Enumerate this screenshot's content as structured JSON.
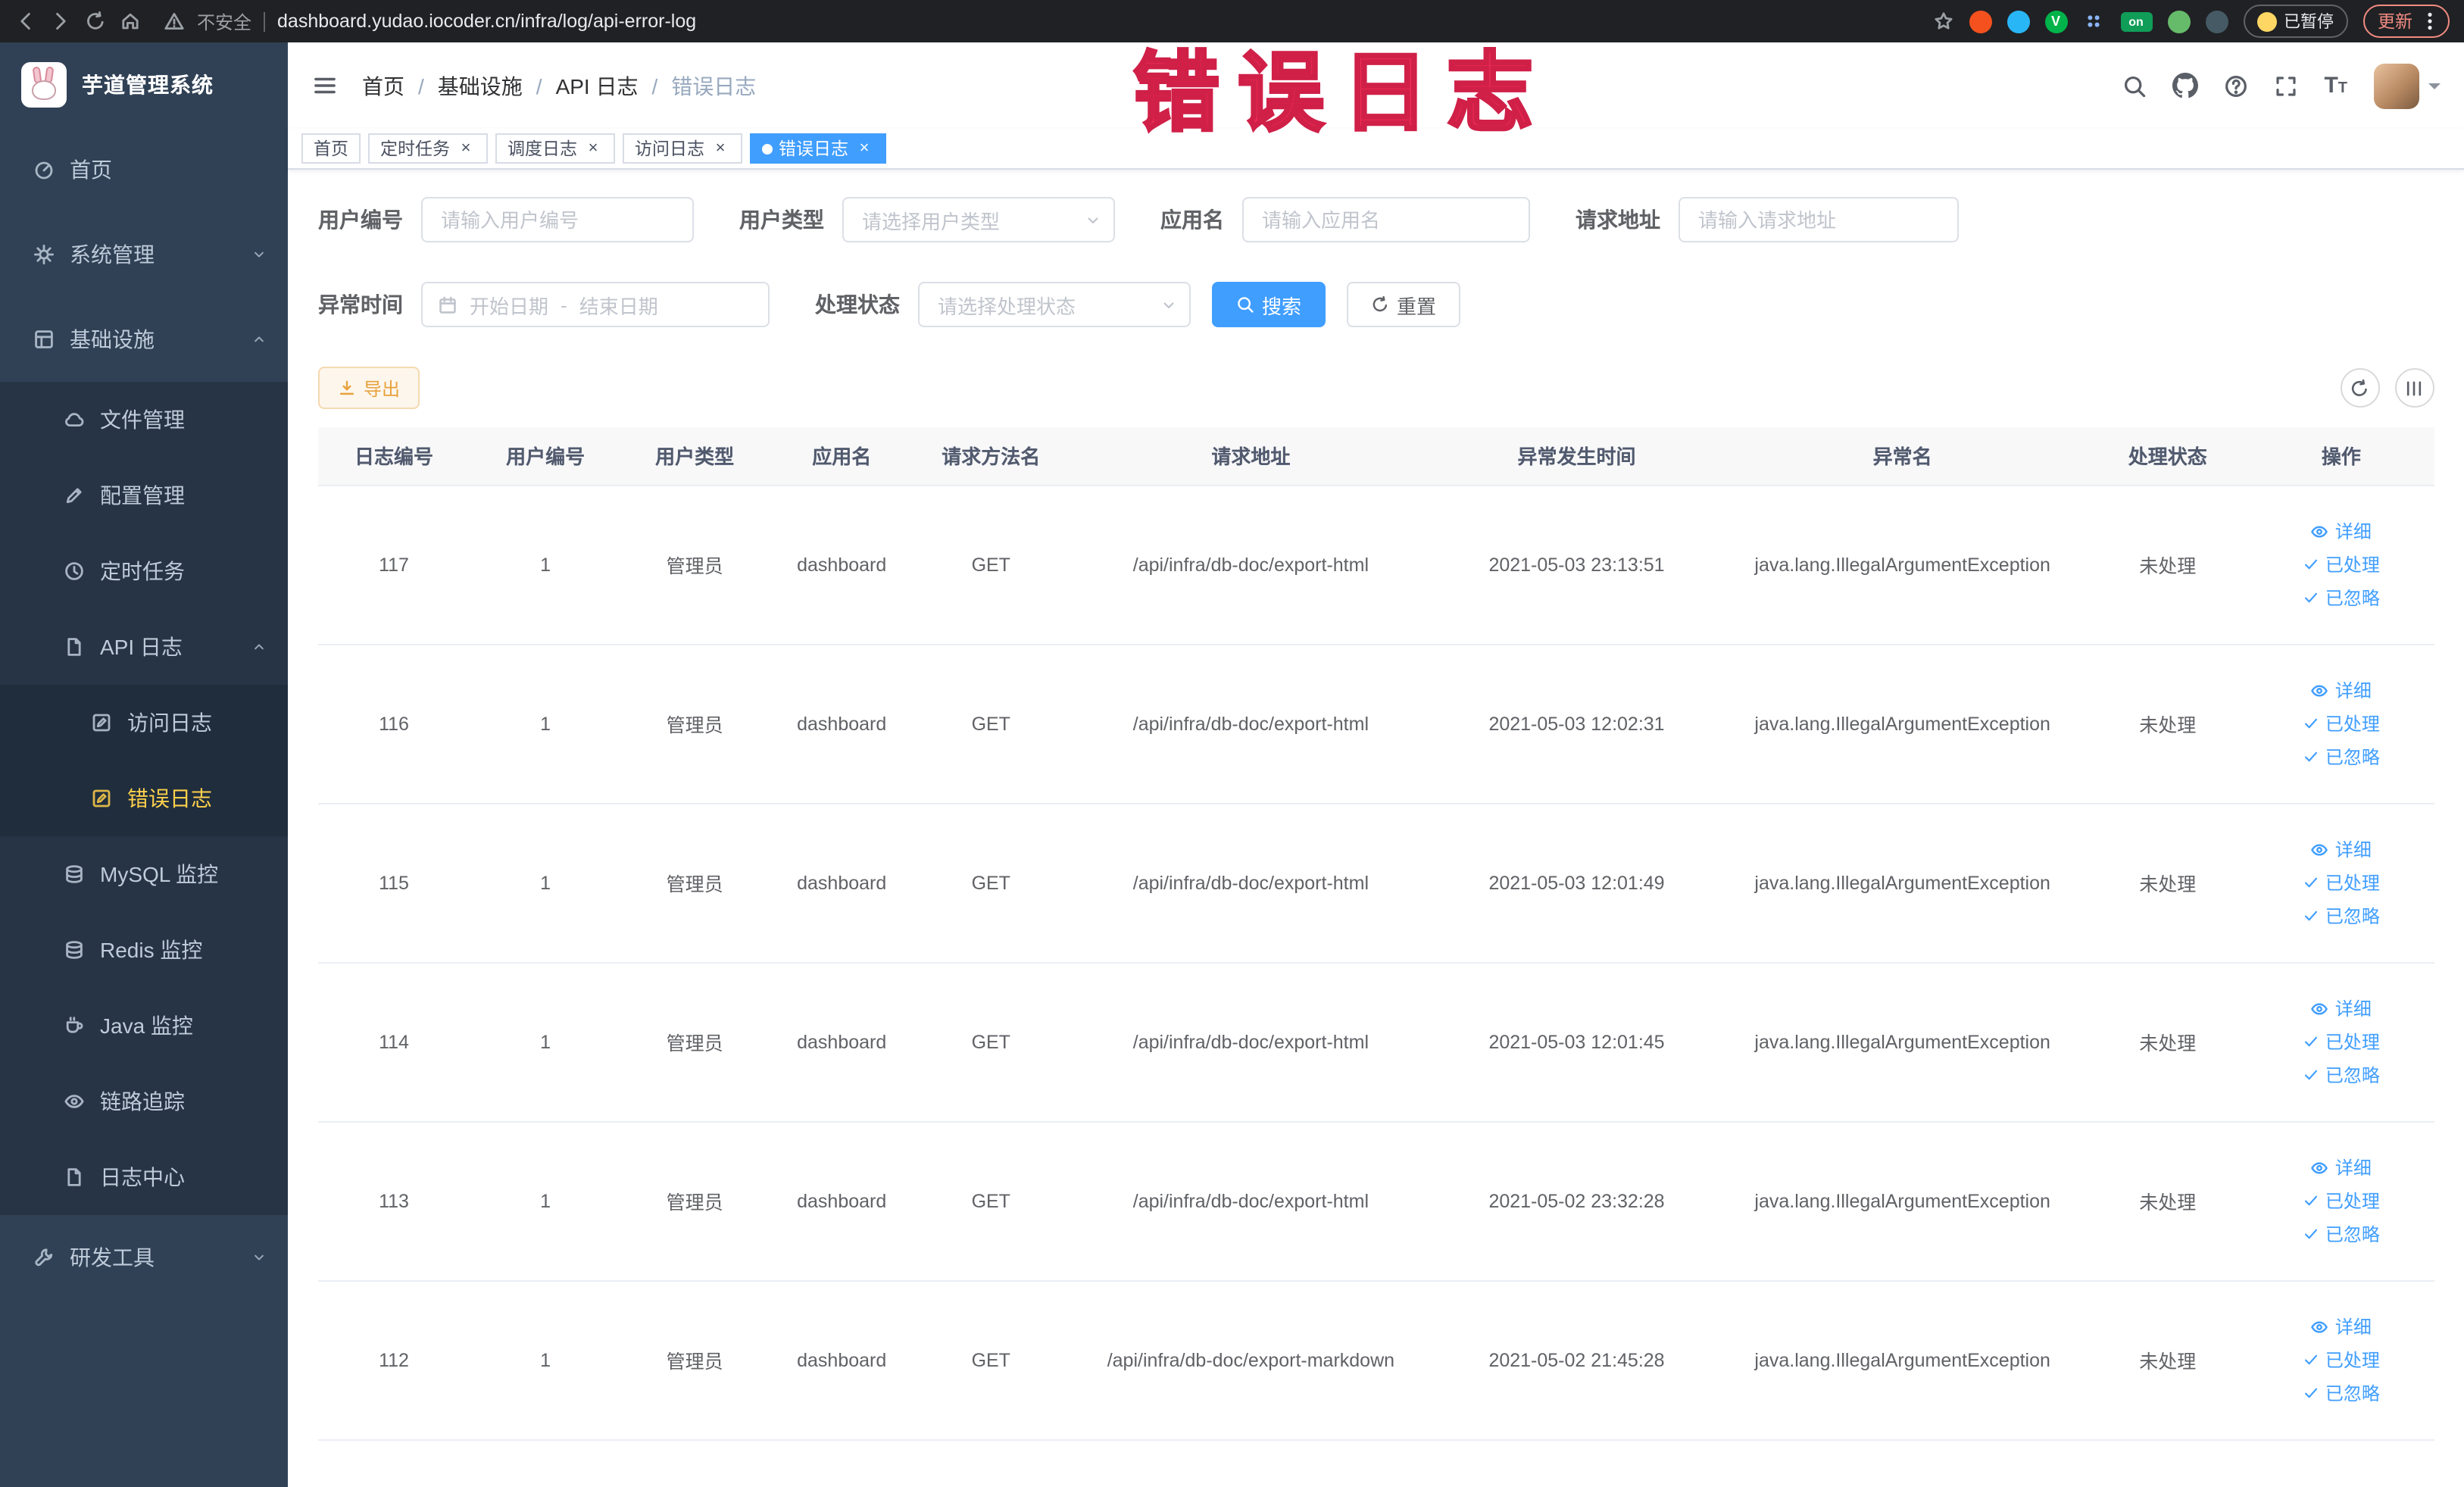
{
  "annotation": {
    "text": "错误日志"
  },
  "colors": {
    "primary": "#409eff",
    "menu_active": "#ffd04b",
    "warning": "#e6a23c",
    "annotation": "#ee2d55",
    "sidebar_bg": "#304156"
  },
  "browser": {
    "security_label": "不安全",
    "url": "dashboard.yudao.iocoder.cn/infra/log/api-error-log",
    "paused_badge": "已暂停",
    "update_button": "更新"
  },
  "sidebar": {
    "logo_title": "芋道管理系统",
    "items": [
      {
        "key": "home",
        "label": "首页",
        "level": 1,
        "icon": "home"
      },
      {
        "key": "system",
        "label": "系统管理",
        "level": 1,
        "icon": "gear",
        "chevron": "down"
      },
      {
        "key": "infra",
        "label": "基础设施",
        "level": 1,
        "icon": "grid",
        "chevron": "up"
      },
      {
        "key": "file",
        "label": "文件管理",
        "level": 2,
        "icon": "cloud"
      },
      {
        "key": "config",
        "label": "配置管理",
        "level": 2,
        "icon": "edit"
      },
      {
        "key": "job",
        "label": "定时任务",
        "level": 2,
        "icon": "clock"
      },
      {
        "key": "api-log",
        "label": "API 日志",
        "level": 2,
        "icon": "doc",
        "chevron": "up"
      },
      {
        "key": "access-log",
        "label": "访问日志",
        "level": 3,
        "icon": "editdoc"
      },
      {
        "key": "error-log",
        "label": "错误日志",
        "level": 3,
        "icon": "editdoc",
        "active": true
      },
      {
        "key": "mysql",
        "label": "MySQL 监控",
        "level": 2,
        "icon": "db"
      },
      {
        "key": "redis",
        "label": "Redis 监控",
        "level": 2,
        "icon": "db"
      },
      {
        "key": "java",
        "label": "Java 监控",
        "level": 2,
        "icon": "coffee"
      },
      {
        "key": "tracer",
        "label": "链路追踪",
        "level": 2,
        "icon": "eye"
      },
      {
        "key": "log-center",
        "label": "日志中心",
        "level": 2,
        "icon": "doc"
      },
      {
        "key": "dev-tools",
        "label": "研发工具",
        "level": 1,
        "icon": "tools",
        "chevron": "down"
      }
    ]
  },
  "header": {
    "breadcrumbs": [
      "首页",
      "基础设施",
      "API 日志",
      "错误日志"
    ]
  },
  "tabs": [
    {
      "key": "home",
      "label": "首页",
      "closable": false,
      "active": false
    },
    {
      "key": "job",
      "label": "定时任务",
      "closable": true,
      "active": false
    },
    {
      "key": "job-log",
      "label": "调度日志",
      "closable": true,
      "active": false
    },
    {
      "key": "access-log",
      "label": "访问日志",
      "closable": true,
      "active": false
    },
    {
      "key": "error-log",
      "label": "错误日志",
      "closable": true,
      "active": true
    }
  ],
  "filters": {
    "user_id": {
      "label": "用户编号",
      "placeholder": "请输入用户编号"
    },
    "user_type": {
      "label": "用户类型",
      "placeholder": "请选择用户类型"
    },
    "app_name": {
      "label": "应用名",
      "placeholder": "请输入应用名"
    },
    "request_url": {
      "label": "请求地址",
      "placeholder": "请输入请求地址"
    },
    "exception_time": {
      "label": "异常时间",
      "start_placeholder": "开始日期",
      "end_placeholder": "结束日期",
      "separator": "-"
    },
    "process_status": {
      "label": "处理状态",
      "placeholder": "请选择处理状态"
    },
    "search_button": "搜索",
    "reset_button": "重置"
  },
  "toolbar": {
    "export_button": "导出"
  },
  "table": {
    "columns": [
      "日志编号",
      "用户编号",
      "用户类型",
      "应用名",
      "请求方法名",
      "请求地址",
      "异常发生时间",
      "异常名",
      "处理状态",
      "操作"
    ],
    "action_labels": [
      "详细",
      "已处理",
      "已忽略"
    ],
    "rows": [
      {
        "id": "117",
        "user_id": "1",
        "user_type": "管理员",
        "app": "dashboard",
        "method": "GET",
        "url": "/api/infra/db-doc/export-html",
        "time": "2021-05-03 23:13:51",
        "exception": "java.lang.IllegalArgumentException",
        "status": "未处理"
      },
      {
        "id": "116",
        "user_id": "1",
        "user_type": "管理员",
        "app": "dashboard",
        "method": "GET",
        "url": "/api/infra/db-doc/export-html",
        "time": "2021-05-03 12:02:31",
        "exception": "java.lang.IllegalArgumentException",
        "status": "未处理"
      },
      {
        "id": "115",
        "user_id": "1",
        "user_type": "管理员",
        "app": "dashboard",
        "method": "GET",
        "url": "/api/infra/db-doc/export-html",
        "time": "2021-05-03 12:01:49",
        "exception": "java.lang.IllegalArgumentException",
        "status": "未处理"
      },
      {
        "id": "114",
        "user_id": "1",
        "user_type": "管理员",
        "app": "dashboard",
        "method": "GET",
        "url": "/api/infra/db-doc/export-html",
        "time": "2021-05-03 12:01:45",
        "exception": "java.lang.IllegalArgumentException",
        "status": "未处理"
      },
      {
        "id": "113",
        "user_id": "1",
        "user_type": "管理员",
        "app": "dashboard",
        "method": "GET",
        "url": "/api/infra/db-doc/export-html",
        "time": "2021-05-02 23:32:28",
        "exception": "java.lang.IllegalArgumentException",
        "status": "未处理"
      },
      {
        "id": "112",
        "user_id": "1",
        "user_type": "管理员",
        "app": "dashboard",
        "method": "GET",
        "url": "/api/infra/db-doc/export-markdown",
        "time": "2021-05-02 21:45:28",
        "exception": "java.lang.IllegalArgumentException",
        "status": "未处理"
      }
    ]
  }
}
